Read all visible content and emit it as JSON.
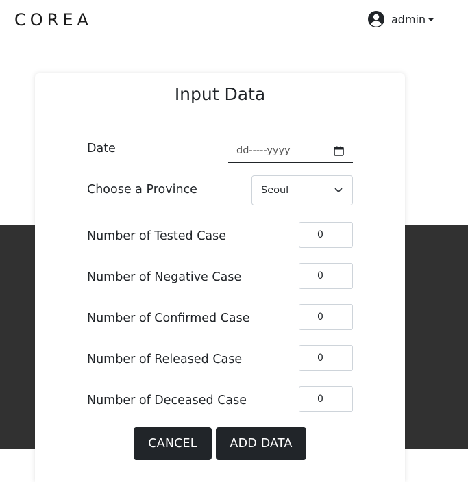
{
  "navbar": {
    "brand": "COREA",
    "username": "admin",
    "avatar_icon": "user-circle-icon",
    "caret_icon": "caret-down-icon"
  },
  "form": {
    "title": "Input Data",
    "date": {
      "label": "Date",
      "placeholder": "dd-----yyyy",
      "icon": "calendar-icon"
    },
    "province": {
      "label": "Choose a Province",
      "selected": "Seoul",
      "icon": "chevron-down-icon"
    },
    "fields": [
      {
        "label": "Number of Tested Case",
        "value": "0"
      },
      {
        "label": "Number of Negative Case",
        "value": "0"
      },
      {
        "label": "Number of Confirmed Case",
        "value": "0"
      },
      {
        "label": "Number of Released Case",
        "value": "0"
      },
      {
        "label": "Number of Deceased Case",
        "value": "0"
      }
    ],
    "cancel_label": "CANCEL",
    "add_label": "ADD DATA"
  },
  "colors": {
    "dark_band": "#313131",
    "button_bg": "#212529",
    "button_text": "#ffffff",
    "text": "#212529"
  }
}
